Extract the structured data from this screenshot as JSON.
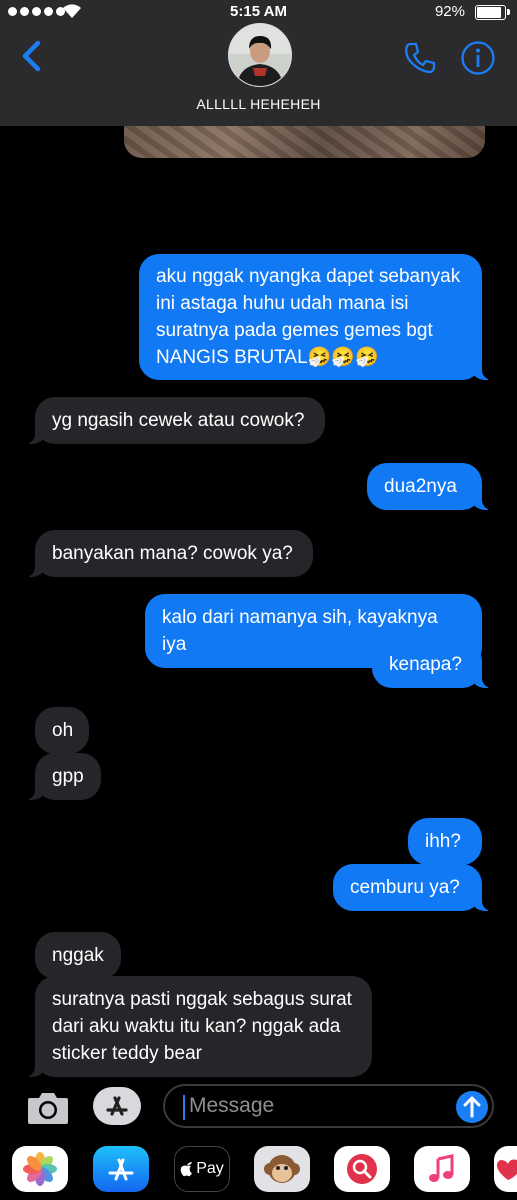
{
  "status": {
    "time": "5:15 AM",
    "battery": "92%"
  },
  "header": {
    "contact_name": "ALLLLL HEHEHEH"
  },
  "messages": [
    {
      "from": "me",
      "text": "aku nggak nyangka dapet sebanyak ini astaga huhu udah mana isi suratnya pada gemes gemes bgt NANGIS BRUTAL🤧🤧🤧"
    },
    {
      "from": "them",
      "text": "yg ngasih cewek atau cowok?"
    },
    {
      "from": "me",
      "text": "dua2nya"
    },
    {
      "from": "them",
      "text": "banyakan mana? cowok ya?"
    },
    {
      "from": "me",
      "text": "kalo dari namanya sih, kayaknya iya"
    },
    {
      "from": "me",
      "text": "kenapa?"
    },
    {
      "from": "them",
      "text": "oh"
    },
    {
      "from": "them",
      "text": "gpp"
    },
    {
      "from": "me",
      "text": "ihh?"
    },
    {
      "from": "me",
      "text": "cemburu ya?"
    },
    {
      "from": "them",
      "text": "nggak"
    },
    {
      "from": "them",
      "text": "suratnya pasti nggak sebagus surat dari aku waktu itu kan? nggak ada sticker teddy bear"
    }
  ],
  "compose": {
    "placeholder": "Message"
  },
  "drawer": {
    "apps": [
      {
        "name": "photos-app-icon"
      },
      {
        "name": "app-store-icon"
      },
      {
        "name": "apple-pay-icon",
        "label": "Pay"
      },
      {
        "name": "animoji-monkey-icon"
      },
      {
        "name": "web-search-icon"
      },
      {
        "name": "music-icon"
      },
      {
        "name": "digital-touch-icon"
      }
    ]
  },
  "colors": {
    "sent_bubble": "#1279f5",
    "received_bubble": "#26262a",
    "accent": "#1c7ef4"
  }
}
